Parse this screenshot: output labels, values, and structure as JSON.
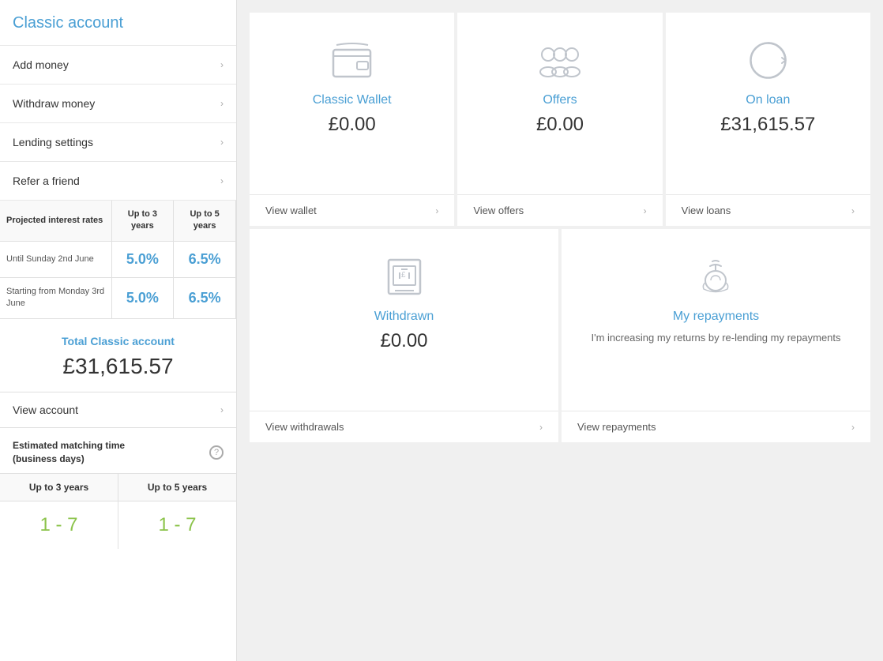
{
  "sidebar": {
    "title": "Classic account",
    "menu_items": [
      {
        "label": "Add money",
        "id": "add-money"
      },
      {
        "label": "Withdraw money",
        "id": "withdraw-money"
      },
      {
        "label": "Lending settings",
        "id": "lending-settings"
      },
      {
        "label": "Refer a friend",
        "id": "refer-friend"
      }
    ],
    "interest_table": {
      "headers": [
        "Projected interest rates",
        "Up to 3 years",
        "Up to 5 years"
      ],
      "rows": [
        {
          "label": "Until Sunday 2nd June",
          "rate_3yr": "5.0%",
          "rate_5yr": "6.5%"
        },
        {
          "label": "Starting from Monday 3rd June",
          "rate_3yr": "5.0%",
          "rate_5yr": "6.5%"
        }
      ]
    },
    "total": {
      "label": "Total Classic account",
      "amount": "£31,615.57"
    },
    "view_account_label": "View account",
    "matching": {
      "title": "Estimated matching time\n(business days)",
      "help_icon": "?",
      "headers": [
        "Up to 3 years",
        "Up to 5 years"
      ],
      "values": [
        "1 - 7",
        "1 - 7"
      ]
    }
  },
  "main": {
    "cards_top": [
      {
        "id": "wallet",
        "title": "Classic Wallet",
        "amount": "£0.00",
        "footer_label": "View wallet",
        "icon": "wallet"
      },
      {
        "id": "offers",
        "title": "Offers",
        "amount": "£0.00",
        "footer_label": "View offers",
        "icon": "offers"
      },
      {
        "id": "loan",
        "title": "On loan",
        "amount": "£31,615.57",
        "footer_label": "View loans",
        "icon": "loan"
      }
    ],
    "cards_bottom": [
      {
        "id": "withdrawn",
        "title": "Withdrawn",
        "amount": "£0.00",
        "footer_label": "View withdrawals",
        "icon": "withdrawn"
      },
      {
        "id": "repayments",
        "title": "My repayments",
        "description": "I'm increasing my returns by re-lending my repayments",
        "footer_label": "View repayments",
        "icon": "repayments"
      }
    ]
  },
  "colors": {
    "blue": "#4a9fd4",
    "green": "#8bc34a",
    "border": "#e0e0e0",
    "text_dark": "#333",
    "text_mid": "#555",
    "icon_gray": "#c0c5cc"
  }
}
